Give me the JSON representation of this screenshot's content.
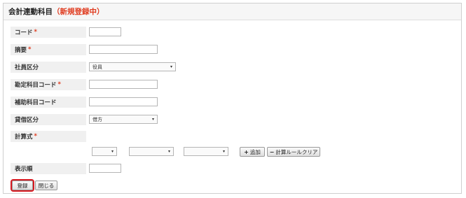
{
  "header": {
    "title": "会計連動科目",
    "subtitle": "（新規登録中）"
  },
  "required_mark": "*",
  "fields": {
    "code": {
      "label": "コード",
      "value": ""
    },
    "summary": {
      "label": "摘要",
      "value": ""
    },
    "employee_type": {
      "label": "社員区分",
      "selected": "役員"
    },
    "account_code": {
      "label": "勘定科目コード",
      "value": ""
    },
    "sub_account_code": {
      "label": "補助科目コード",
      "value": ""
    },
    "debit_credit": {
      "label": "貸借区分",
      "selected": "借方"
    },
    "formula": {
      "label": "計算式",
      "select1": "",
      "select2": "",
      "select3": "",
      "add_label": "追加",
      "clear_label": "計算ルールクリア"
    },
    "display_order": {
      "label": "表示順",
      "value": ""
    }
  },
  "actions": {
    "register_label": "登録",
    "close_label": "閉じる"
  },
  "icons": {
    "caret": "▾",
    "plus": "+",
    "minus": "−"
  },
  "colors": {
    "required": "#e03b1f",
    "primary_outline": "#d71a21"
  }
}
